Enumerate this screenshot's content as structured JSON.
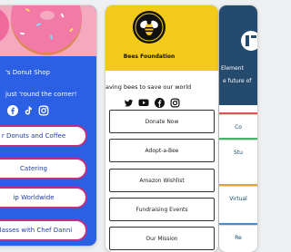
{
  "donut_card": {
    "title": "'s Donut Shop",
    "tagline": "just 'round the corner!",
    "social_icons": [
      "facebook-icon",
      "tiktok-icon",
      "instagram-icon"
    ],
    "buttons": [
      "r Donuts and Coffee",
      "Catering",
      "ip Worldwide",
      "Classes with Chef Danni"
    ]
  },
  "bees_card": {
    "title": "Bees Foundation",
    "tagline": "aving bees to save our world",
    "social_icons": [
      "twitter-icon",
      "youtube-icon",
      "facebook-icon",
      "instagram-icon"
    ],
    "buttons": [
      "Donate Now",
      "Adopt-a-Bee",
      "Amazon Wishlist",
      "Fundraising Events",
      "Our Mission"
    ]
  },
  "element_card": {
    "title": "Element",
    "tagline": "e future of",
    "buttons": [
      "Co",
      "Stu",
      "Virtual",
      "Re"
    ]
  },
  "colors": {
    "donut_background": "#2b5fe4",
    "donut_button_border": "#c32f7c",
    "bees_accent": "#f4ca1a",
    "element_background": "#244a6e"
  }
}
